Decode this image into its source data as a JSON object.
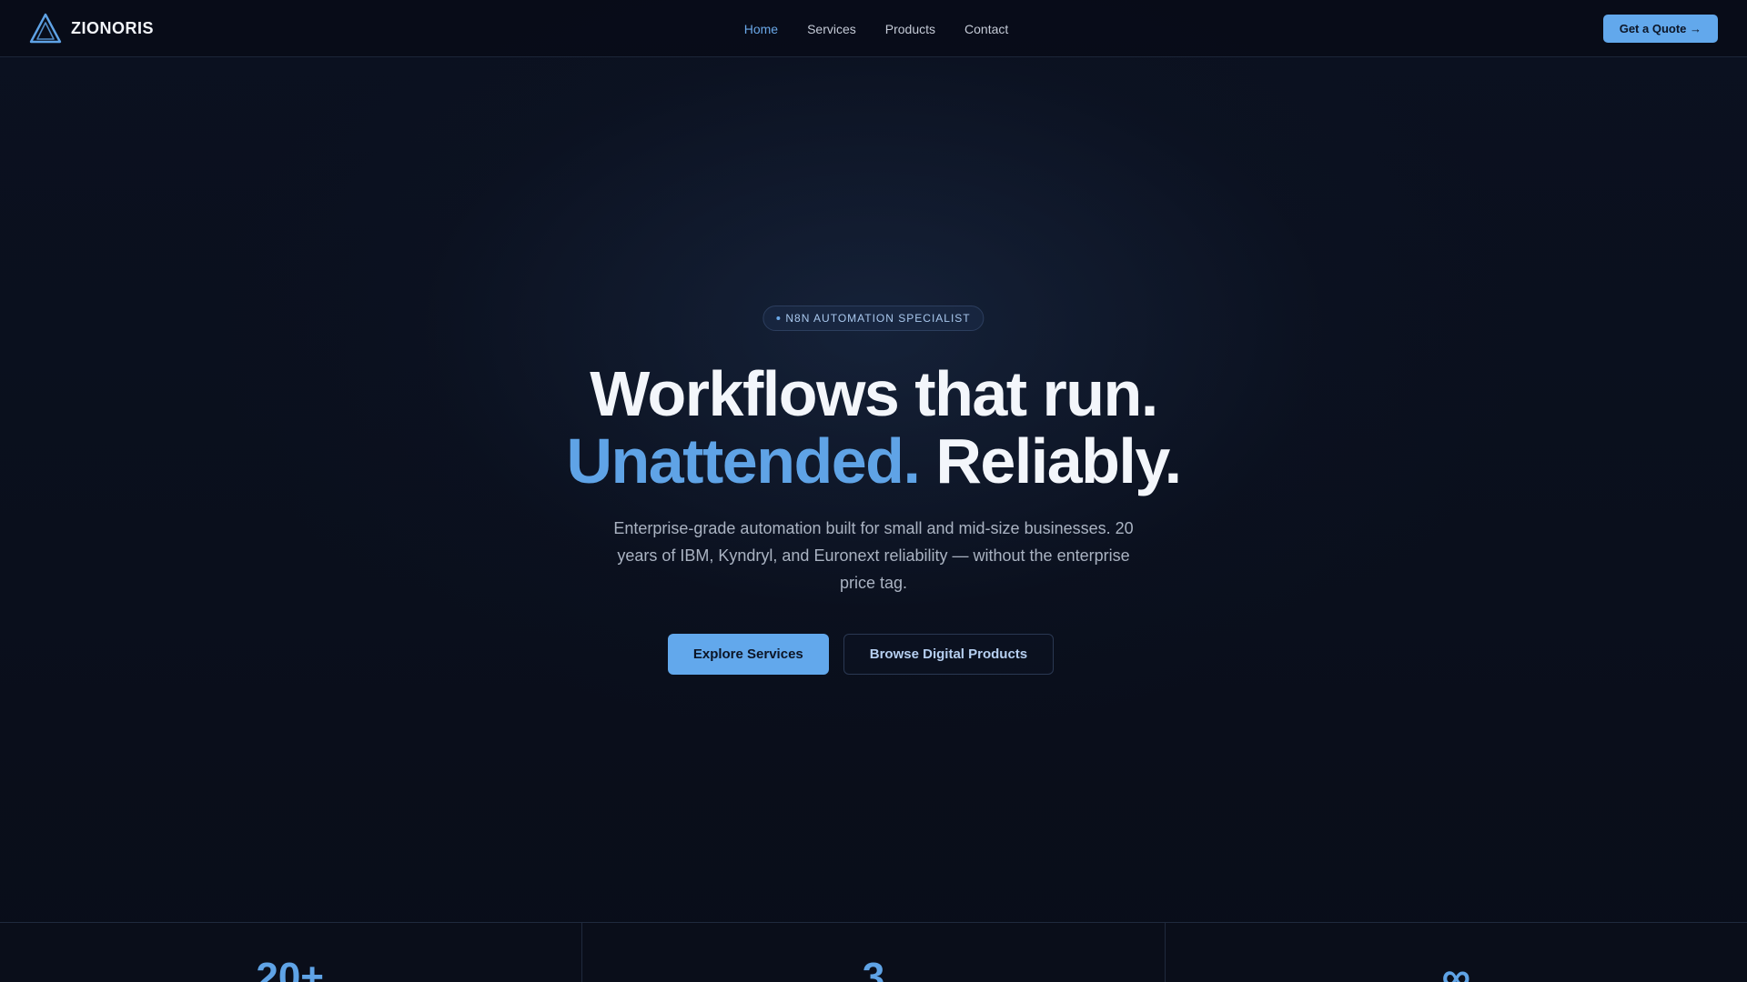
{
  "brand": {
    "name": "ZIONORIS",
    "logo_icon": "triangle-logo-icon",
    "accent_color": "#62a8ec"
  },
  "nav": {
    "links": [
      {
        "label": "Home",
        "active": true
      },
      {
        "label": "Services",
        "active": false
      },
      {
        "label": "Products",
        "active": false
      },
      {
        "label": "Contact",
        "active": false
      }
    ],
    "cta_label": "Get a Quote →"
  },
  "hero": {
    "badge": "N8N AUTOMATION SPECIALIST",
    "headline_line1": "Workflows that run.",
    "headline_accent": "Unattended.",
    "headline_rest": " Reliably.",
    "subtitle": "Enterprise-grade automation built for small and mid-size businesses. 20 years of IBM, Kyndryl, and Euronext reliability — without the enterprise price tag.",
    "primary_button": "Explore Services",
    "secondary_button": "Browse Digital Products"
  },
  "stats": [
    {
      "value": "20+"
    },
    {
      "value": "3"
    },
    {
      "value": "∞"
    }
  ]
}
